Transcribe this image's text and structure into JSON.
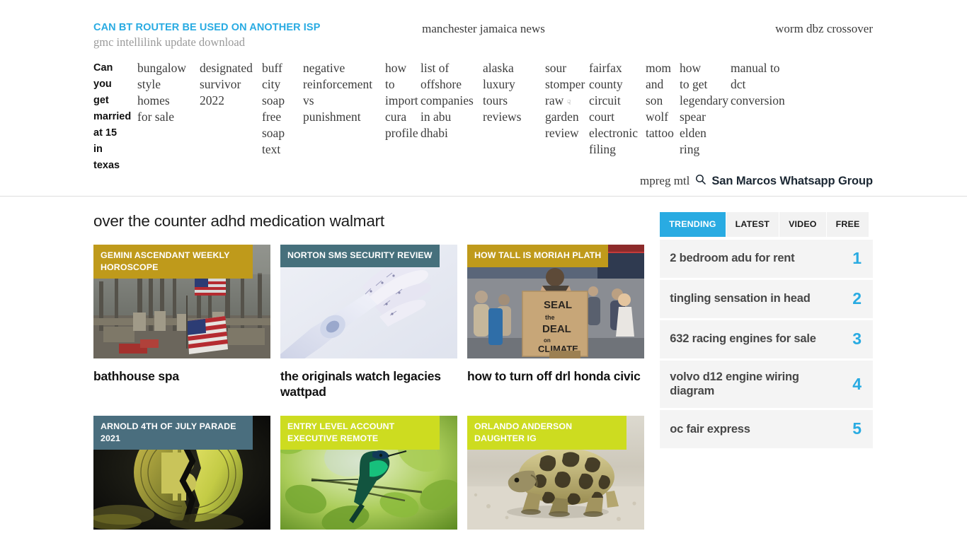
{
  "header": {
    "brand_title": "CAN BT ROUTER BE USED ON ANOTHER ISP",
    "brand_subtitle": "gmc intellilink update download",
    "center_text": "manchester jamaica news",
    "right_text": "worm dbz crossover"
  },
  "nav": {
    "items": [
      {
        "label": "Can you get married at 15 in texas",
        "active": true
      },
      {
        "label": "bungalow style homes for sale",
        "active": false
      },
      {
        "label": "designated survivor 2022",
        "active": false
      },
      {
        "label": "buff city soap free soap text",
        "active": false
      },
      {
        "label": "negative reinforcement vs punishment",
        "active": false
      },
      {
        "label": "how to import cura profile",
        "active": false
      },
      {
        "label": "list of offshore companies in abu dhabi",
        "active": false
      },
      {
        "label": "alaska luxury tours reviews",
        "active": false
      },
      {
        "label": "sour stomper raw garden review",
        "active": false,
        "has_caret": true
      },
      {
        "label": "fairfax county circuit court electronic filing",
        "active": false
      },
      {
        "label": "mom and son wolf tattoo",
        "active": false
      },
      {
        "label": "how to get legendary spear elden ring",
        "active": false
      },
      {
        "label": "manual to dct conversion",
        "active": false
      }
    ]
  },
  "search": {
    "hint": "mpreg mtl",
    "label": "San Marcos Whatsapp Group",
    "icon": "search-icon"
  },
  "main": {
    "page_title": "over the counter adhd medication walmart",
    "cards": [
      {
        "label": "GEMINI ASCENDANT WEEKLY HOROSCOPE",
        "title": "bathhouse spa",
        "label_color": "#bf9a1b",
        "image": "refinery-american-flags"
      },
      {
        "label": "NORTON SMS SECURITY REVIEW",
        "title": "the originals watch legacies wattpad",
        "label_color": "#46707c",
        "image": "robotic-hand"
      },
      {
        "label": "HOW TALL IS MORIAH PLATH",
        "title": "how to turn off drl honda civic",
        "label_color": "#bf9a1b",
        "image": "climate-protest-sign"
      },
      {
        "label": "ARNOLD 4TH OF JULY PARADE 2021",
        "title": "",
        "label_color": "#4a6e7e",
        "image": "cracked-bitcoin"
      },
      {
        "label": "ENTRY LEVEL ACCOUNT EXECUTIVE REMOTE",
        "title": "",
        "label_color": "#cddc20",
        "image": "hummingbird-branch"
      },
      {
        "label": "ORLANDO ANDERSON DAUGHTER IG",
        "title": "",
        "label_color": "#cddc20",
        "image": "leopard-tortoise"
      }
    ]
  },
  "sidebar": {
    "tabs": [
      {
        "label": "TRENDING",
        "active": true
      },
      {
        "label": "LATEST",
        "active": false
      },
      {
        "label": "VIDEO",
        "active": false
      },
      {
        "label": "FREE",
        "active": false
      }
    ],
    "trending": [
      {
        "text": "2 bedroom adu for rent",
        "rank": "1"
      },
      {
        "text": "tingling sensation in head",
        "rank": "2"
      },
      {
        "text": "632 racing engines for sale",
        "rank": "3"
      },
      {
        "text": "volvo d12 engine wiring diagram",
        "rank": "4"
      },
      {
        "text": "oc fair express",
        "rank": "5"
      }
    ]
  },
  "colors": {
    "accent": "#29abe2",
    "gold": "#bf9a1b",
    "teal": "#46707c",
    "lime": "#cddc20",
    "text": "#1c1c1c"
  }
}
